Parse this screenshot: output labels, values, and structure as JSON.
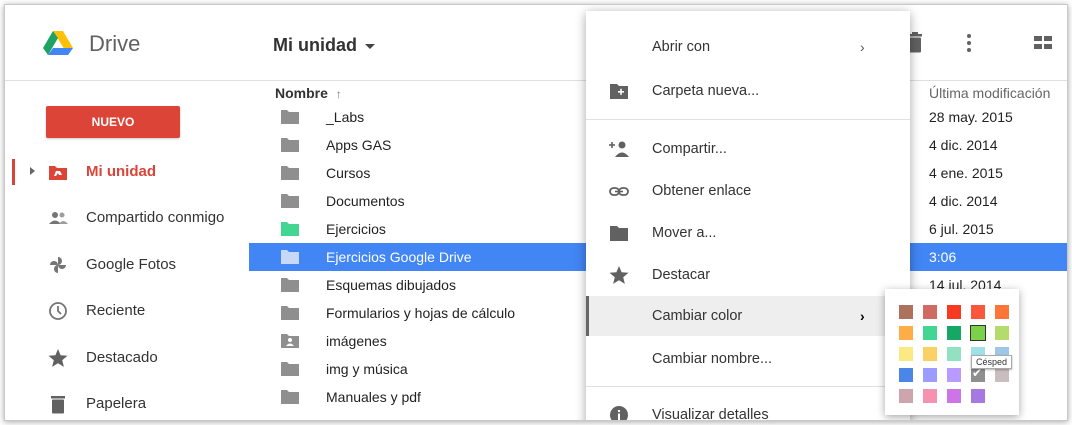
{
  "header": {
    "brand": "Drive",
    "breadcrumb": "Mi unidad"
  },
  "sidebar": {
    "new_label": "NUEVO",
    "items": [
      {
        "label": "Mi unidad",
        "icon": "drive-folder-icon",
        "active": true
      },
      {
        "label": "Compartido conmigo",
        "icon": "people-icon"
      },
      {
        "label": "Google Fotos",
        "icon": "pinwheel-icon"
      },
      {
        "label": "Reciente",
        "icon": "clock-icon"
      },
      {
        "label": "Destacado",
        "icon": "star-icon"
      },
      {
        "label": "Papelera",
        "icon": "trash-icon"
      }
    ]
  },
  "list": {
    "name_header": "Nombre",
    "sort_arrow": "↑",
    "date_header": "Última modificación",
    "rows": [
      {
        "name": "_Labs",
        "date": "28 may. 2015",
        "color": "#8f8f8f"
      },
      {
        "name": "Apps GAS",
        "date": "4 dic. 2014",
        "color": "#8f8f8f"
      },
      {
        "name": "Cursos",
        "date": "4 ene. 2015",
        "color": "#8f8f8f"
      },
      {
        "name": "Documentos",
        "date": "4 dic. 2014",
        "color": "#8f8f8f"
      },
      {
        "name": "Ejercicios",
        "date": "6 jul. 2015",
        "color": "#43d692"
      },
      {
        "name": "Ejercicios Google Drive",
        "date": "3:06",
        "color": "#8f8f8f",
        "selected": true
      },
      {
        "name": "Esquemas dibujados",
        "date": "14 jul. 2014",
        "color": "#8f8f8f"
      },
      {
        "name": "Formularios y hojas de cálculo",
        "date": "",
        "color": "#8f8f8f"
      },
      {
        "name": "imágenes",
        "date": "",
        "color": "#8f8f8f",
        "icon": "image-folder-icon"
      },
      {
        "name": "img y música",
        "date": "",
        "color": "#8f8f8f"
      },
      {
        "name": "Manuales y pdf",
        "date": "",
        "color": "#8f8f8f"
      }
    ]
  },
  "menu": {
    "items": [
      {
        "label": "Abrir con",
        "submenu": "›"
      },
      {
        "label": "Carpeta nueva...",
        "icon": "new-folder-icon"
      },
      {
        "label": "Compartir...",
        "icon": "add-person-icon"
      },
      {
        "label": "Obtener enlace",
        "icon": "link-icon"
      },
      {
        "label": "Mover a...",
        "icon": "folder-icon"
      },
      {
        "label": "Destacar",
        "icon": "star-icon"
      },
      {
        "label": "Cambiar color",
        "submenu": "›",
        "hover": true
      },
      {
        "label": "Cambiar nombre..."
      },
      {
        "label": "Visualizar detalles",
        "icon": "info-icon"
      }
    ]
  },
  "palette": {
    "tooltip": "Césped",
    "rows": [
      [
        "#ac725e",
        "#d06b64",
        "#f83a22",
        "#fa573c",
        "#ff7537"
      ],
      [
        "#ffad46",
        "#42d692",
        "#16a765",
        "#7bd148",
        "#b3dc6c"
      ],
      [
        "#fbe983",
        "#fad165",
        "#92e1c0",
        "#9fe1e7",
        "#9fc6e7"
      ],
      [
        "#4986e7",
        "#9a9cff",
        "#b99aff",
        "#8f8f8f",
        "#cabdbf"
      ],
      [
        "#cca6ac",
        "#f691b2",
        "#cd74e6",
        "#a47ae2"
      ]
    ],
    "chosen": "#7bd148",
    "checked": "#8f8f8f"
  }
}
